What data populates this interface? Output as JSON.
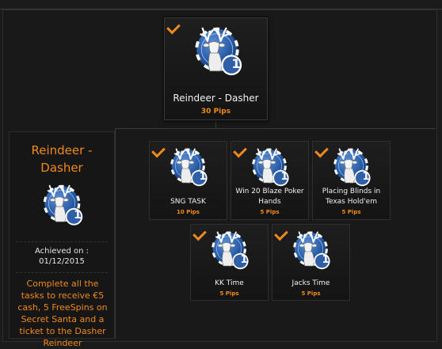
{
  "colors": {
    "accent": "#f08a1c",
    "badge_blue": "#2a5ea8",
    "bg": "#1b1b1b"
  },
  "main_tile": {
    "name": "Reindeer - Dasher",
    "pips": "30 Pips",
    "level": "1",
    "completed": true,
    "icon": "reindeer-badge-icon"
  },
  "side_panel": {
    "title_line1": "Reindeer -",
    "title_line2": "Dasher",
    "level": "1",
    "achieved_label": "Achieved on :",
    "achieved_date": "01/12/2015",
    "description": "Complete all the tasks to receive €5 cash, 5 FreeSpins on Secret Santa and a ticket to the Dasher Reindeer"
  },
  "tasks": [
    {
      "name": "SNG TASK",
      "pips": "10 Pips",
      "level": "1",
      "completed": true
    },
    {
      "name": "Win 20 Blaze Poker Hands",
      "pips": "5 Pips",
      "level": "1",
      "completed": true
    },
    {
      "name": "Placing Blinds in Texas Hold'em",
      "pips": "5 Pips",
      "level": "1",
      "completed": true
    },
    {
      "name": "KK Time",
      "pips": "5 Pips",
      "level": "1",
      "completed": true
    },
    {
      "name": "Jacks Time",
      "pips": "5 Pips",
      "level": "1",
      "completed": true
    }
  ]
}
